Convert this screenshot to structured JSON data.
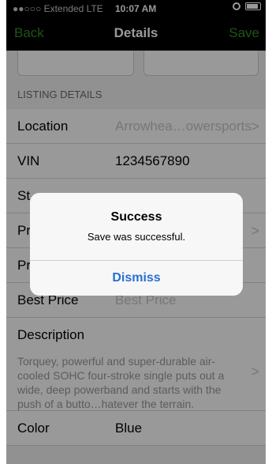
{
  "status": {
    "carrier": "●●○○○ Extended  LTE",
    "time": "10:07 AM"
  },
  "nav": {
    "back": "Back",
    "title": "Details",
    "save": "Save"
  },
  "section": {
    "header": "LISTING DETAILS"
  },
  "rows": [
    {
      "label": "Location",
      "value": "Arrowhea…owersports",
      "muted": true
    },
    {
      "label": "VIN",
      "value": "1234567890"
    },
    {
      "label": "St",
      "value": ""
    },
    {
      "label": "Pr",
      "value": ""
    },
    {
      "label": "Pr",
      "value": ""
    },
    {
      "label": "Best Price",
      "placeholder": "Best Price"
    }
  ],
  "description": {
    "label": "Description",
    "text": "Torquey, powerful and super-durable air-cooled SOHC four-stroke single puts out a wide, deep powerband and starts with the push of a butto…hatever the terrain."
  },
  "color_row": {
    "label": "Color",
    "value": "Blue"
  },
  "alert": {
    "title": "Success",
    "message": "Save was successful.",
    "button": "Dismiss"
  }
}
